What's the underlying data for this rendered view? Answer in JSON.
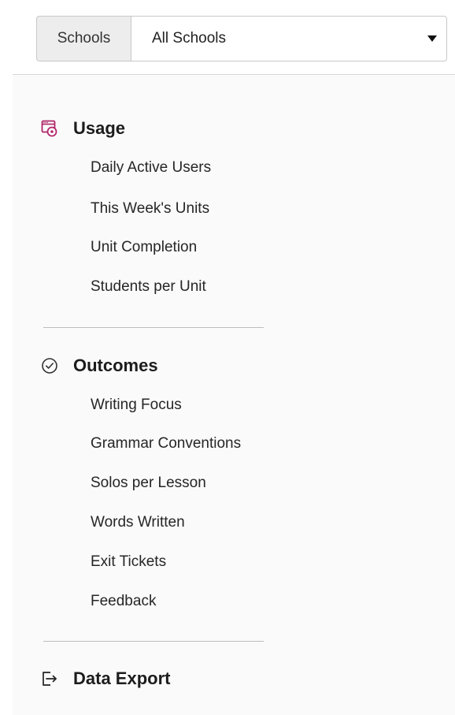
{
  "filter": {
    "label": "Schools",
    "selected": "All Schools"
  },
  "sections": {
    "usage": {
      "title": "Usage",
      "icon": "usage-icon",
      "icon_color": "#b0266a",
      "items": [
        "Daily Active Users",
        "This Week's Units",
        "Unit Completion",
        "Students per Unit"
      ]
    },
    "outcomes": {
      "title": "Outcomes",
      "icon": "checkmark-circle-icon",
      "items": [
        "Writing Focus",
        "Grammar Conventions",
        "Solos per Lesson",
        "Words Written",
        "Exit Tickets",
        "Feedback"
      ]
    },
    "export": {
      "title": "Data Export",
      "icon": "export-icon"
    }
  }
}
